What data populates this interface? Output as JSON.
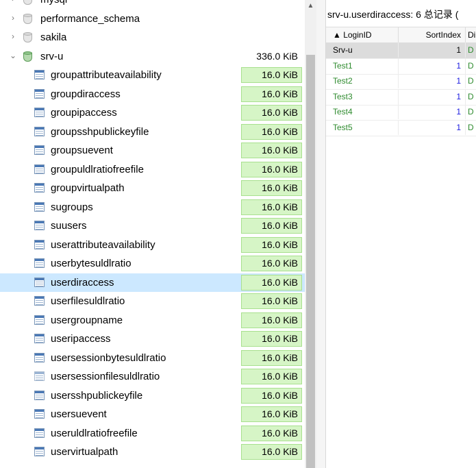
{
  "tree": {
    "databases": [
      {
        "name": "mysql",
        "expanded": false,
        "icon": "database-icon"
      },
      {
        "name": "performance_schema",
        "expanded": false,
        "icon": "database-icon"
      },
      {
        "name": "sakila",
        "expanded": false,
        "icon": "database-icon"
      },
      {
        "name": "srv-u",
        "expanded": true,
        "icon": "database-icon-green",
        "size": "336.0 KiB"
      }
    ],
    "tables": [
      {
        "name": "groupattributeavailability",
        "size": "16.0 KiB"
      },
      {
        "name": "groupdiraccess",
        "size": "16.0 KiB"
      },
      {
        "name": "groupipaccess",
        "size": "16.0 KiB"
      },
      {
        "name": "groupsshpublickeyfile",
        "size": "16.0 KiB"
      },
      {
        "name": "groupsuevent",
        "size": "16.0 KiB"
      },
      {
        "name": "groupuldlratiofreefile",
        "size": "16.0 KiB"
      },
      {
        "name": "groupvirtualpath",
        "size": "16.0 KiB"
      },
      {
        "name": "sugroups",
        "size": "16.0 KiB"
      },
      {
        "name": "suusers",
        "size": "16.0 KiB"
      },
      {
        "name": "userattributeavailability",
        "size": "16.0 KiB"
      },
      {
        "name": "userbytesuldlratio",
        "size": "16.0 KiB"
      },
      {
        "name": "userdiraccess",
        "size": "16.0 KiB",
        "selected": true
      },
      {
        "name": "userfilesuldlratio",
        "size": "16.0 KiB"
      },
      {
        "name": "usergroupname",
        "size": "16.0 KiB"
      },
      {
        "name": "useripaccess",
        "size": "16.0 KiB"
      },
      {
        "name": "usersessionbytesuldlratio",
        "size": "16.0 KiB"
      },
      {
        "name": "usersessionfilesuldlratio",
        "size": "16.0 KiB"
      },
      {
        "name": "usersshpublickeyfile",
        "size": "16.0 KiB"
      },
      {
        "name": "usersuevent",
        "size": "16.0 KiB"
      },
      {
        "name": "useruldlratiofreefile",
        "size": "16.0 KiB"
      },
      {
        "name": "uservirtualpath",
        "size": "16.0 KiB"
      }
    ],
    "expand_arrow": "›",
    "collapse_arrow": "⌄"
  },
  "scrollbar": {
    "up_arrow": "▲"
  },
  "grid": {
    "title": "srv-u.userdiraccess: 6 总记录 (",
    "columns": [
      {
        "label": "▲ LoginID"
      },
      {
        "label": "SortIndex"
      },
      {
        "label": "Di"
      }
    ],
    "rows": [
      {
        "login": "Srv-u",
        "sort": "1",
        "dir": "D",
        "current": true
      },
      {
        "login": "Test1",
        "sort": "1",
        "dir": "D"
      },
      {
        "login": "Test2",
        "sort": "1",
        "dir": "D"
      },
      {
        "login": "Test3",
        "sort": "1",
        "dir": "D"
      },
      {
        "login": "Test4",
        "sort": "1",
        "dir": "D"
      },
      {
        "login": "Test5",
        "sort": "1",
        "dir": "D"
      }
    ]
  },
  "colors": {
    "selected_row": "#cce8ff",
    "size_badge_bg": "#d6f5c6",
    "size_badge_border": "#a8e08e",
    "login_green": "#2e8b2e",
    "sort_blue": "#1a1ae0"
  }
}
